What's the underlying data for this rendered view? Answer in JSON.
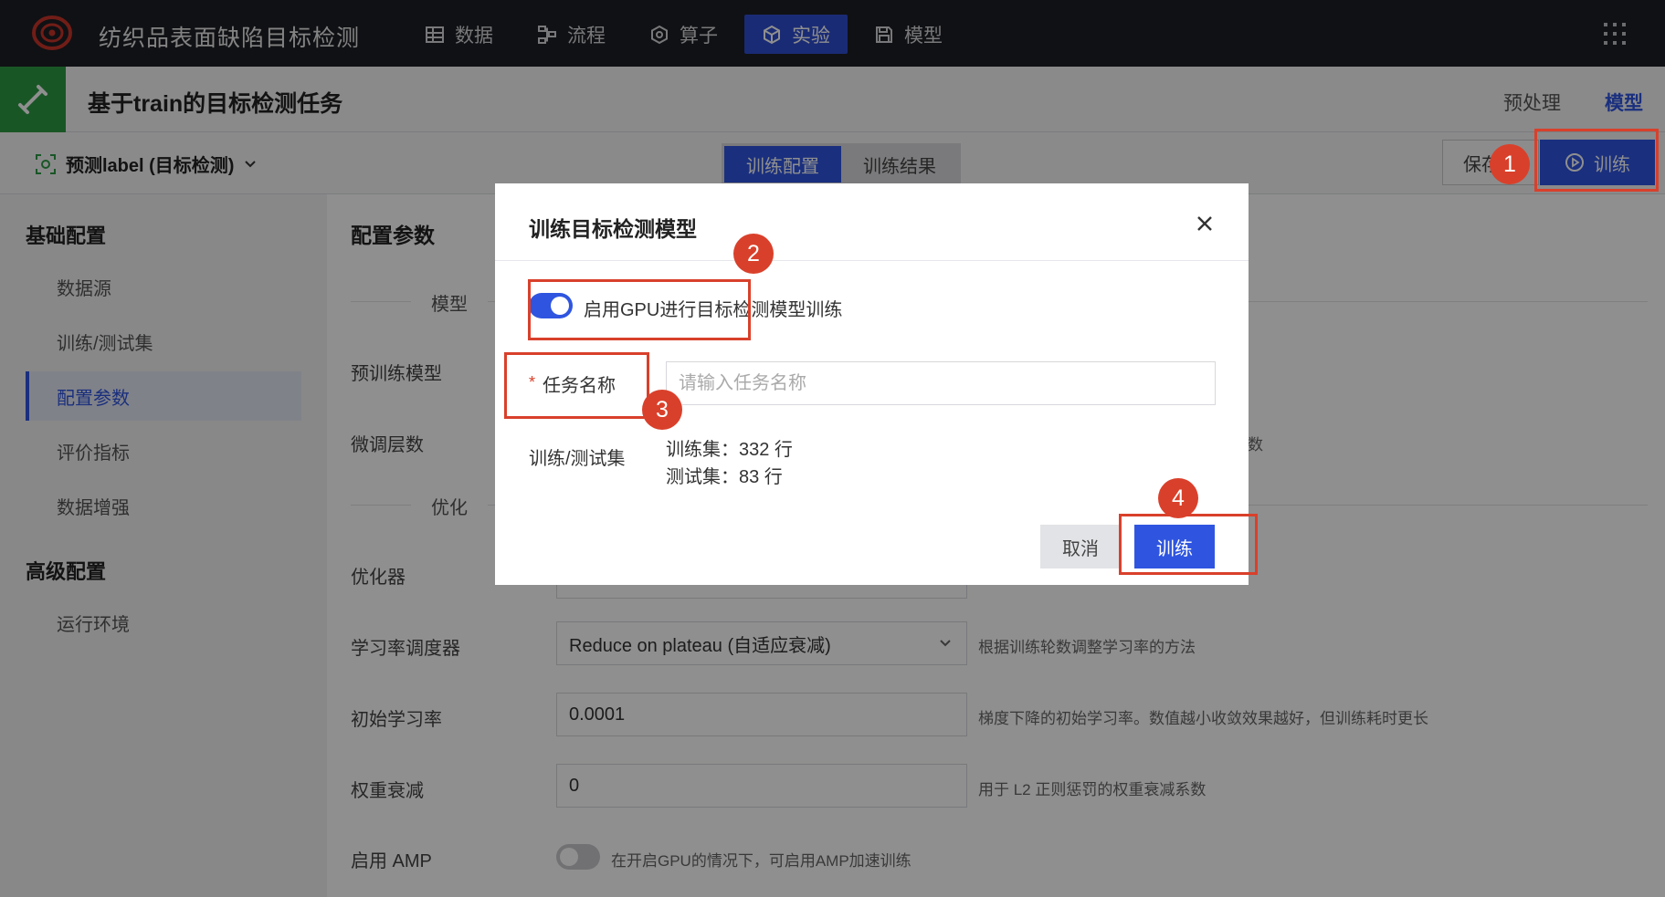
{
  "app": {
    "title": "纺织品表面缺陷目标检测",
    "nav": [
      {
        "label": "数据",
        "icon": "table-icon"
      },
      {
        "label": "流程",
        "icon": "flow-icon"
      },
      {
        "label": "算子",
        "icon": "operator-icon"
      },
      {
        "label": "实验",
        "icon": "cube-icon",
        "active": true
      },
      {
        "label": "模型",
        "icon": "save-icon"
      }
    ],
    "colors": {
      "topbar": "#1d1f24",
      "accent": "#2f55e0",
      "task_icon": "#2e9a45",
      "annotation": "#d9402b"
    }
  },
  "task": {
    "title": "基于train的目标检测任务",
    "header_tabs": [
      "预处理",
      "模型"
    ],
    "active_header_tab": "模型"
  },
  "toolbar": {
    "label_select": "预测label (目标检测)",
    "segments": [
      "训练配置",
      "训练结果"
    ],
    "active_segment": "训练配置",
    "save_label": "保存",
    "train_label": "训练"
  },
  "sidebar": {
    "groups": [
      {
        "title": "基础配置",
        "items": [
          "数据源",
          "训练/测试集",
          "配置参数",
          "评价指标",
          "数据增强"
        ]
      },
      {
        "title": "高级配置",
        "items": [
          "运行环境"
        ]
      }
    ],
    "active_item": "配置参数"
  },
  "config": {
    "title": "配置参数",
    "section_model": "模型",
    "section_optim": "优化",
    "pretrained_label": "预训练模型",
    "finetune_label": "微调层数",
    "finetune_hint_tail": "数",
    "optimizer_label": "优化器",
    "scheduler_label": "学习率调度器",
    "scheduler_value": "Reduce on plateau (自适应衰减)",
    "scheduler_hint": "根据训练轮数调整学习率的方法",
    "lr_label": "初始学习率",
    "lr_value": "0.0001",
    "lr_hint": "梯度下降的初始学习率。数值越小收敛效果越好，但训练耗时更长",
    "wd_label": "权重衰减",
    "wd_value": "0",
    "wd_hint": "用于 L2 正则惩罚的权重衰减系数",
    "amp_label": "启用 AMP",
    "amp_hint": "在开启GPU的情况下，可启用AMP加速训练"
  },
  "modal": {
    "title": "训练目标检测模型",
    "gpu_label": "启用GPU进行目标检测模型训练",
    "gpu_enabled": true,
    "required_mark": "*",
    "name_label": "任务名称",
    "name_placeholder": "请输入任务名称",
    "name_value": "",
    "split_label": "训练/测试集",
    "train_rows": "训练集：332 行",
    "test_rows": "测试集：83 行",
    "cancel_label": "取消",
    "ok_label": "训练"
  },
  "annotations": [
    "1",
    "2",
    "3",
    "4"
  ]
}
